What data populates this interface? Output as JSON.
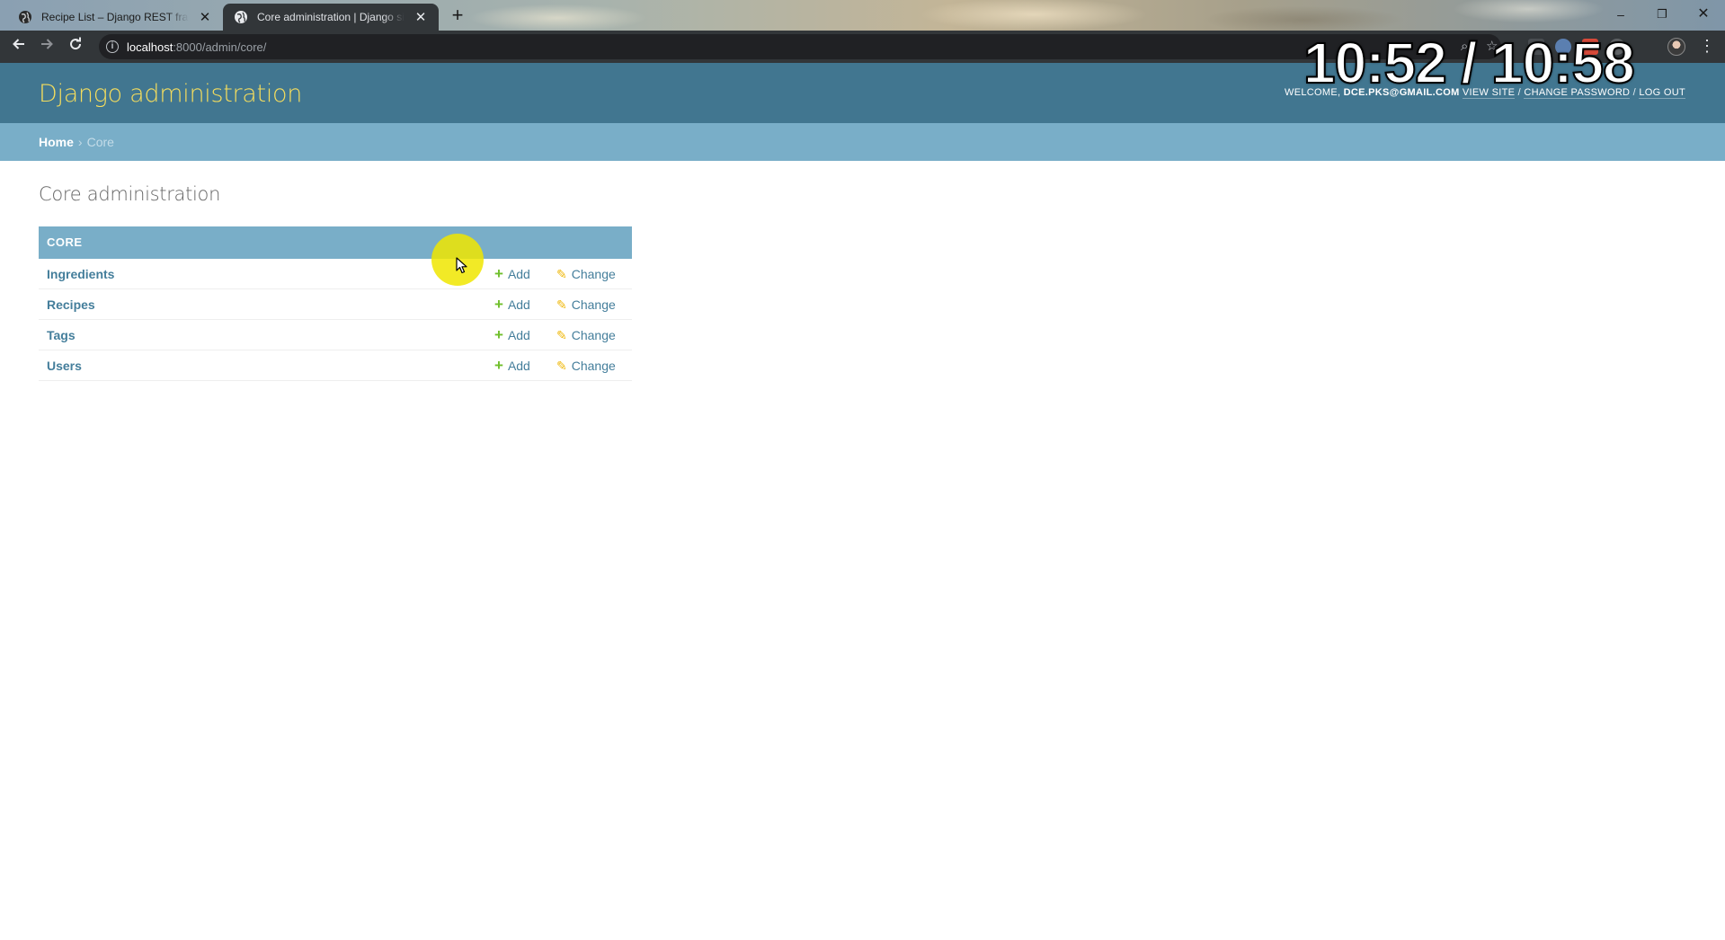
{
  "browser": {
    "tabs": [
      {
        "title": "Recipe List – Django REST frame",
        "active": false
      },
      {
        "title": "Core administration | Django site",
        "active": true
      }
    ],
    "new_tab_label": "+",
    "url_host": "localhost",
    "url_path": ":8000/admin/core/",
    "window_controls": {
      "minimize": "–",
      "maximize": "❐",
      "close": "✕"
    }
  },
  "overlay": {
    "timer": "10:52 / 10:58"
  },
  "header": {
    "branding": "Django administration",
    "welcome": "WELCOME,",
    "email": "DCE.PKS@GMAIL.COM",
    "view_site": "VIEW SITE",
    "change_password": "CHANGE PASSWORD",
    "log_out": "LOG OUT",
    "separator": "/"
  },
  "breadcrumbs": {
    "home": "Home",
    "separator": "›",
    "current": "Core"
  },
  "main": {
    "title": "Core administration",
    "module": {
      "caption": "CORE",
      "models": [
        {
          "name": "Ingredients",
          "add": "Add",
          "change": "Change"
        },
        {
          "name": "Recipes",
          "add": "Add",
          "change": "Change"
        },
        {
          "name": "Tags",
          "add": "Add",
          "change": "Change"
        },
        {
          "name": "Users",
          "add": "Add",
          "change": "Change"
        }
      ]
    }
  },
  "colors": {
    "header_bg": "#417690",
    "branding": "#f5dd5d",
    "breadcrumbs_bg": "#79aec8",
    "link": "#447e9b",
    "add_icon": "#70bf2b",
    "change_icon": "#efb80b"
  }
}
